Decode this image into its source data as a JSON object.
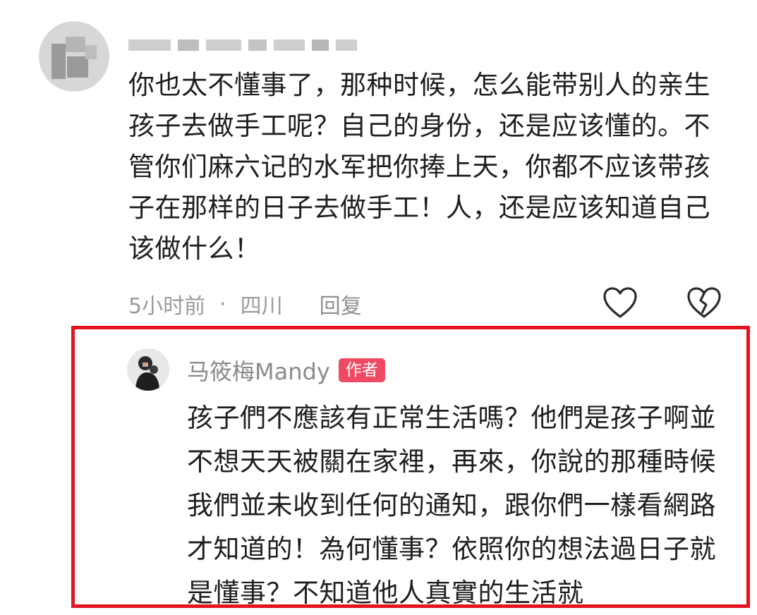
{
  "comment": {
    "text": "你也太不懂事了，那种时候，怎么能带别人的亲生孩子去做手工呢？自己的身份，还是应该懂的。不管你们麻六记的水军把你捧上天，你都不应该带孩子在那样的日子去做手工！人，还是应该知道自己该做什么！",
    "time": "5小时前",
    "separator": "·",
    "location": "四川",
    "reply_label": "回复",
    "like_icon": "heart-outline-icon",
    "dislike_icon": "broken-heart-icon"
  },
  "reply": {
    "author": "马筱梅Mandy",
    "badge": "作者",
    "text": "孩子們不應該有正常生活嗎？他們是孩子啊並不想天天被關在家裡，再來，你說的那種時候我們並未收到任何的通知，跟你們一樣看網路才知道的！為何懂事？依照你的想法過日子就是懂事？不知道他人真實的生活就"
  },
  "colors": {
    "highlight_border": "#e3141f",
    "badge": "#f04a63",
    "meta_text": "#9b9b9b"
  }
}
